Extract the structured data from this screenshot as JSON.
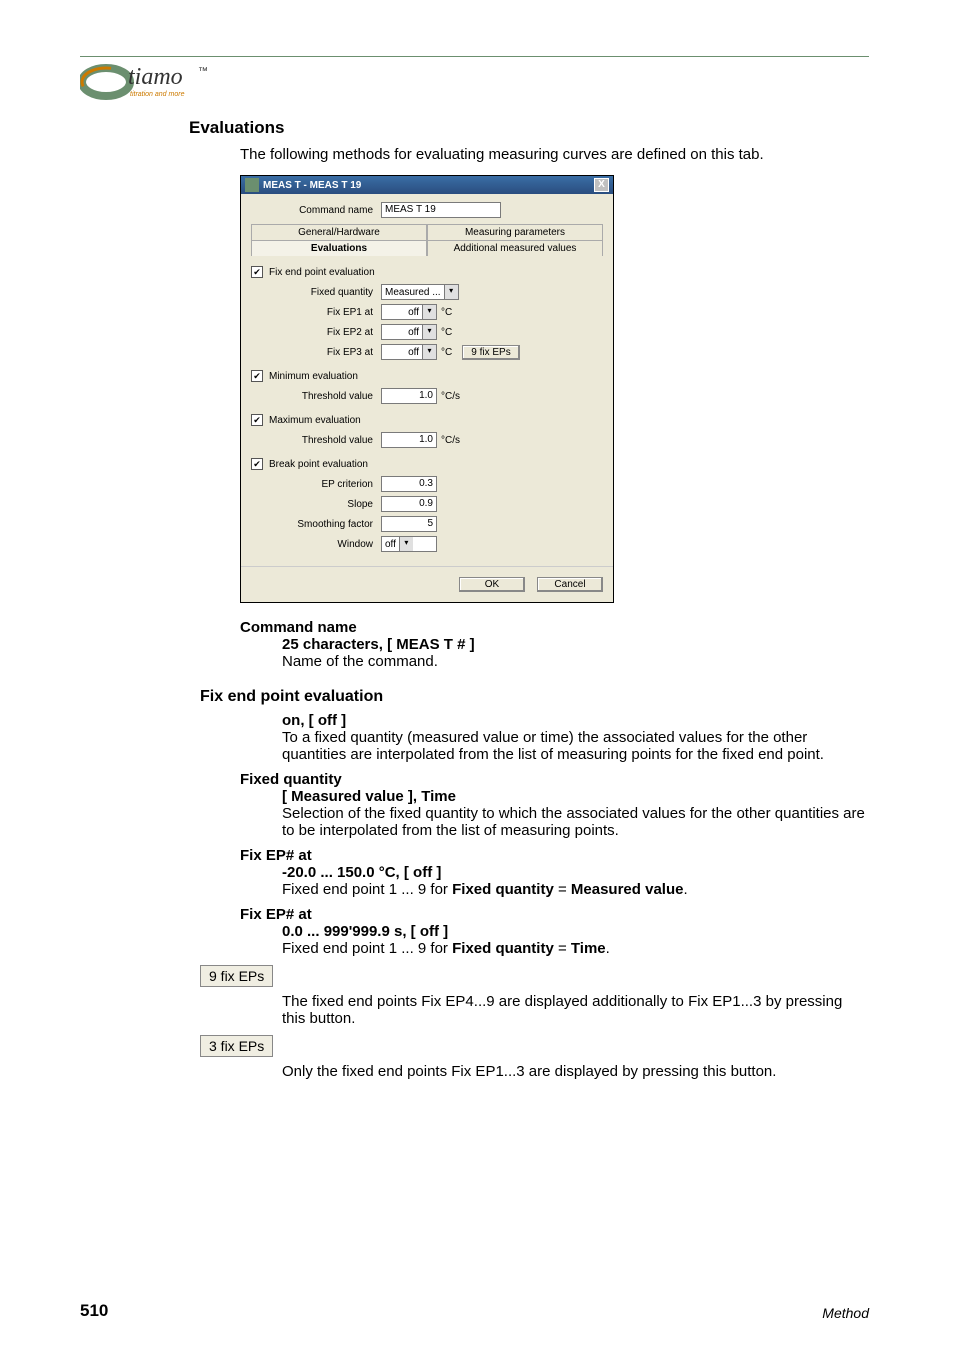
{
  "logo": {
    "brand": "tiamo",
    "tagline": "titration and more",
    "tm": "™"
  },
  "section_heading": "Evaluations",
  "intro": "The following methods for evaluating measuring curves are defined on this tab.",
  "dialog": {
    "title": "MEAS T - MEAS T 19",
    "close": "X",
    "command_name_label": "Command name",
    "command_name_value": "MEAS T 19",
    "tabs": {
      "general": "General/Hardware",
      "measuring": "Measuring parameters",
      "evaluations": "Evaluations",
      "additional": "Additional measured values"
    },
    "fix_ep_eval": {
      "checkbox_label": "Fix end point evaluation",
      "fixed_quantity_label": "Fixed quantity",
      "fixed_quantity_value": "Measured ...",
      "ep1_label": "Fix EP1 at",
      "ep1_value": "off",
      "ep2_label": "Fix EP2 at",
      "ep2_value": "off",
      "ep3_label": "Fix EP3 at",
      "ep3_value": "off",
      "unit": "°C",
      "btn_9fix": "9 fix EPs"
    },
    "min_eval": {
      "checkbox_label": "Minimum evaluation",
      "threshold_label": "Threshold value",
      "threshold_value": "1.0",
      "unit": "°C/s"
    },
    "max_eval": {
      "checkbox_label": "Maximum evaluation",
      "threshold_label": "Threshold value",
      "threshold_value": "1.0",
      "unit": "°C/s"
    },
    "bp_eval": {
      "checkbox_label": "Break point evaluation",
      "epcrit_label": "EP criterion",
      "epcrit_value": "0.3",
      "slope_label": "Slope",
      "slope_value": "0.9",
      "smooth_label": "Smoothing factor",
      "smooth_value": "5",
      "window_label": "Window",
      "window_value": "off"
    },
    "ok": "OK",
    "cancel": "Cancel"
  },
  "def_command_name": {
    "term": "Command name",
    "range": "25 characters, [ MEAS T # ]",
    "desc": "Name of the command."
  },
  "h3_fixep": "Fix end point evaluation",
  "def_fixep_onoff": {
    "range": "on, [ off ]",
    "desc": "To a fixed quantity (measured value or time) the associated values for the other quantities are interpolated from the list of measuring points for the fixed end point."
  },
  "def_fixed_quantity": {
    "term": "Fixed quantity",
    "range": "[ Measured value ], Time",
    "desc": "Selection of the fixed quantity to which the associated values for the other quantities are to be interpolated from the list of measuring points."
  },
  "def_fixep_mv": {
    "term": "Fix EP# at",
    "range": "-20.0 ... 150.0 °C, [ off ]",
    "desc_pre": "Fixed end point 1 ... 9 for ",
    "fq": "Fixed quantity",
    "eq": " = ",
    "mv": "Measured value",
    "period": "."
  },
  "def_fixep_time": {
    "term": "Fix EP# at",
    "range": "0.0 ... 999'999.9 s, [ off ]",
    "desc_pre": "Fixed end point 1 ... 9 for ",
    "fq": "Fixed quantity",
    "eq": " = ",
    "tm": "Time",
    "period": "."
  },
  "btn_9fix": "9 fix EPs",
  "btn_9fix_desc": "The fixed end points Fix EP4...9 are displayed additionally to Fix EP1...3 by pressing this button.",
  "btn_3fix": "3 fix EPs",
  "btn_3fix_desc": "Only the fixed end points Fix EP1...3 are displayed by pressing this button.",
  "footer": {
    "page": "510",
    "category": "Method"
  }
}
